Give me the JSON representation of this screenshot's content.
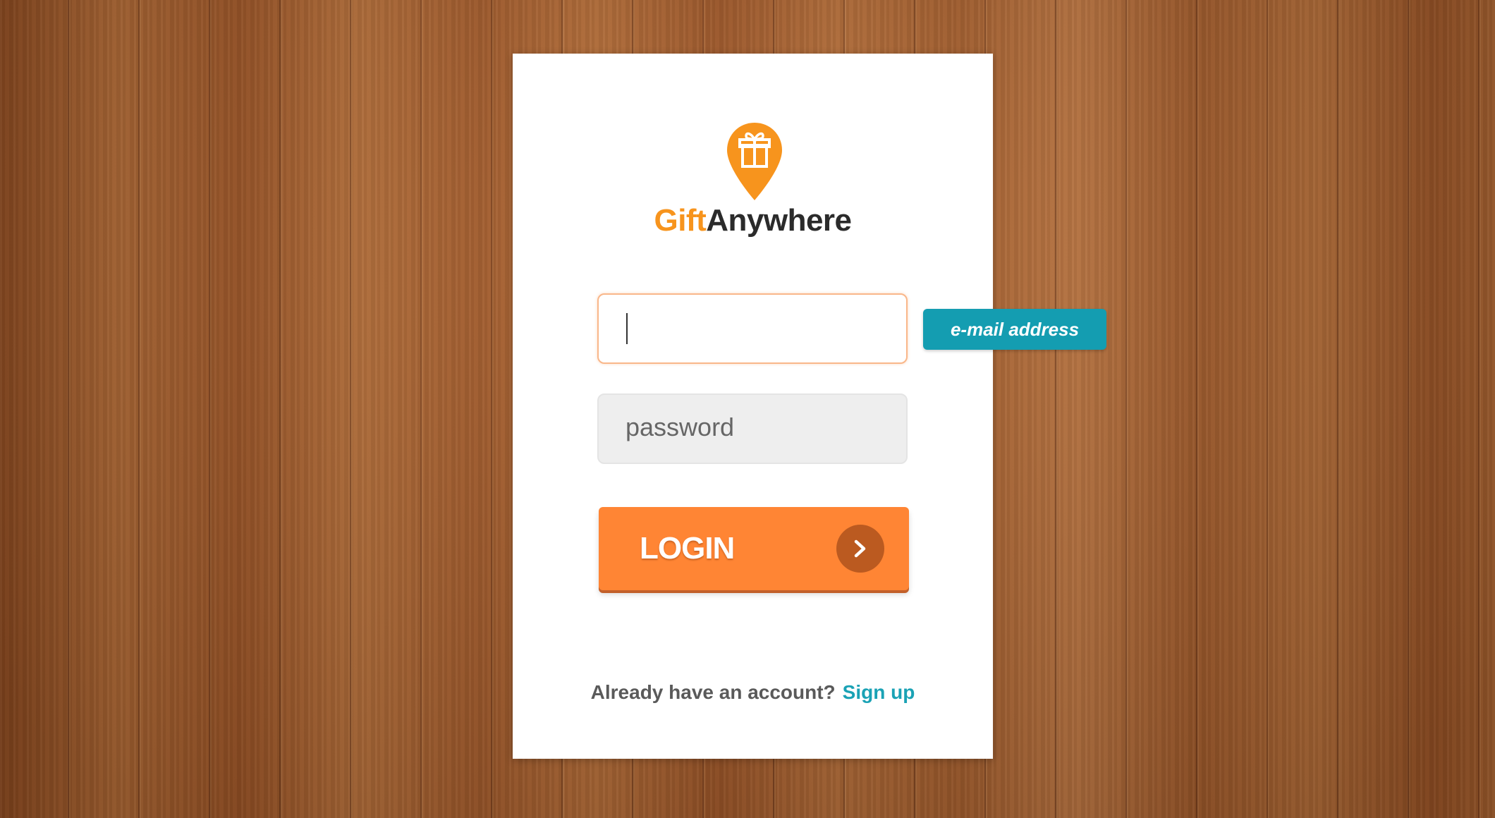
{
  "logo": {
    "brand_part1": "Gift",
    "brand_part2": "Anywhere",
    "icon": "gift-location-pin-icon",
    "pin_color": "#f7941d"
  },
  "login_form": {
    "email": {
      "value": "",
      "placeholder": "",
      "tooltip": "e-mail address"
    },
    "password": {
      "value": "",
      "placeholder": "password"
    },
    "login_button": {
      "label": "LOGIN",
      "icon": "chevron-right-icon"
    },
    "signup": {
      "prompt": "Already have an account?",
      "link": "Sign up"
    }
  },
  "colors": {
    "accent": "#ff8534",
    "link": "#1aa2b5",
    "tooltip": "#149db1",
    "button_arrow_bg": "#bb5a20"
  }
}
